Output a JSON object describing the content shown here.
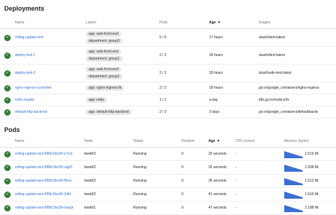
{
  "deployments": {
    "title": "Deployments",
    "headers": [
      "Name",
      "Labels",
      "Pods",
      "Age",
      "Images"
    ],
    "rows": [
      {
        "name": "rolling-update-test",
        "labels": [
          "app: web-front-end",
          "department: group3"
        ],
        "pods": "5 / 5",
        "age": "17 hours",
        "image": "skarl/client:latest"
      },
      {
        "name": "deploy-test-1",
        "labels": [
          "app: web-front-end",
          "department: group1"
        ],
        "pods": "2 / 2",
        "age": "18 hours",
        "image": "skarl/client:latest"
      },
      {
        "name": "deploy-test-2",
        "labels": [
          "app: web-front-end",
          "department: group2"
        ],
        "pods": "2 / 2",
        "age": "18 hours",
        "image": "skarl/node-test:latest"
      },
      {
        "name": "nginx-ingress-controller",
        "labels": [
          "app: nginx-ingress-lb"
        ],
        "pods": "2 / 2",
        "age": "18 hours",
        "image": "gcr.io/google_containers/nginx-ingress"
      },
      {
        "name": "redis-master",
        "labels": [
          "app: redis"
        ],
        "pods": "1 / 1",
        "age": "a day",
        "image": "k8s.gcr.io/redis:e2e"
      },
      {
        "name": "default-http-backend",
        "labels": [
          "app: default-http-backend"
        ],
        "pods": "2 / 2",
        "age": "3 days",
        "image": "gcr.io/google_containers/defaultbacke"
      }
    ]
  },
  "pods": {
    "title": "Pods",
    "headers": [
      "Name",
      "Node",
      "Status",
      "Restarts",
      "Age",
      "CPU (cores)",
      "Memory (bytes)"
    ],
    "rows": [
      {
        "name": "rolling-update-test-6f86c5bc99-e7cm",
        "node": "tweb02",
        "status": "Running",
        "restarts": "0",
        "age": "25 seconds",
        "cpu": "-",
        "memory": "1.516 Mi"
      },
      {
        "name": "rolling-update-test-6f86c5bc99-vqjz5",
        "node": "tweb02",
        "status": "Running",
        "restarts": "0",
        "age": "32 seconds",
        "cpu": "-",
        "memory": "1.508 Mi"
      },
      {
        "name": "rolling-update-test-6f86c5bc99-f8nsr",
        "node": "tweb02",
        "status": "Running",
        "restarts": "0",
        "age": "36 seconds",
        "cpu": "-",
        "memory": "1.512 Mi"
      },
      {
        "name": "rolling-update-test-6f86c5bc99-2dfd",
        "node": "tweb02",
        "status": "Running",
        "restarts": "0",
        "age": "41 seconds",
        "cpu": "-",
        "memory": "1.516 Mi"
      },
      {
        "name": "rolling-update-test-6f86c5bc99-hswpt",
        "node": "tweb01",
        "status": "Running",
        "restarts": "0",
        "age": "47 seconds",
        "cpu": "-",
        "memory": "2.188 Mi"
      }
    ]
  },
  "icons": {
    "status": "check-circle-icon",
    "sort": "arrow-down-icon"
  },
  "colors": {
    "link": "#3b6fd1",
    "ok": "#2e7d32",
    "chip": "#e8e8e8",
    "spark": "#3b6fd1"
  }
}
